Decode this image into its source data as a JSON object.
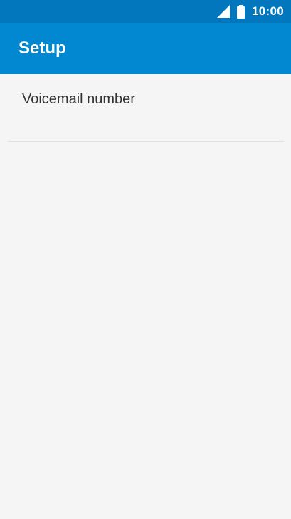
{
  "status_bar": {
    "time": "10:00",
    "signal_icon": "signal-icon",
    "battery_icon": "battery-icon",
    "background_color": "#0277bd"
  },
  "app_bar": {
    "title": "Setup",
    "background_color": "#0288d1"
  },
  "settings_list": {
    "items": [
      {
        "label": "Voicemail number"
      }
    ]
  }
}
